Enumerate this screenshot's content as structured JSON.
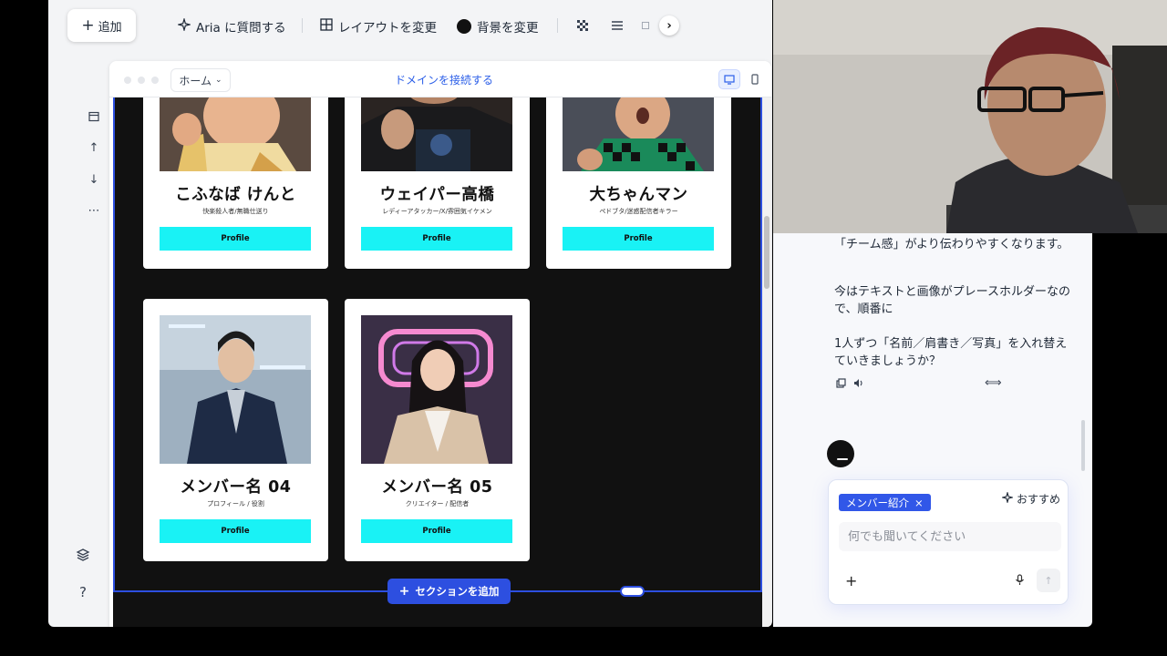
{
  "toolbar": {
    "add_label": "追加",
    "ask_aria_label": "Aria に質問する",
    "layout_label": "レイアウトを変更",
    "background_label": "背景を変更"
  },
  "browser": {
    "page_select": "ホーム",
    "connect_domain": "ドメインを接続する"
  },
  "members": [
    {
      "name": "こふなば けんと",
      "role": "快楽殺人者/無職仕送り",
      "button": "Profile"
    },
    {
      "name": "ウェイパー高橋",
      "role": "レディーアタッカー/X/雰囲気イケメン",
      "button": "Profile"
    },
    {
      "name": "大ちゃんマン",
      "role": "ペドブタ/迷惑配信者キラー",
      "button": "Profile"
    },
    {
      "name": "メンバー名 04",
      "role": "プロフィール / 役割",
      "button": "Profile"
    },
    {
      "name": "メンバー名 05",
      "role": "クリエイター / 配信者",
      "button": "Profile"
    }
  ],
  "add_section_label": "セクションを追加",
  "chat": {
    "messages": [
      "「チーム感」がより伝わりやすくなります。",
      "今はテキストと画像がプレースホルダーなので、順番に",
      "1人ずつ「名前／肩書き／写真」を入れ替えていきましょうか？"
    ],
    "chip_label": "メンバー紹介",
    "chip_close": "×",
    "recommend_label": "おすすめ",
    "input_placeholder": "何でも聞いてください"
  },
  "colors": {
    "accent": "#2d4fe0",
    "profile_button": "#19f2f5",
    "canvas_bg": "#111111"
  }
}
